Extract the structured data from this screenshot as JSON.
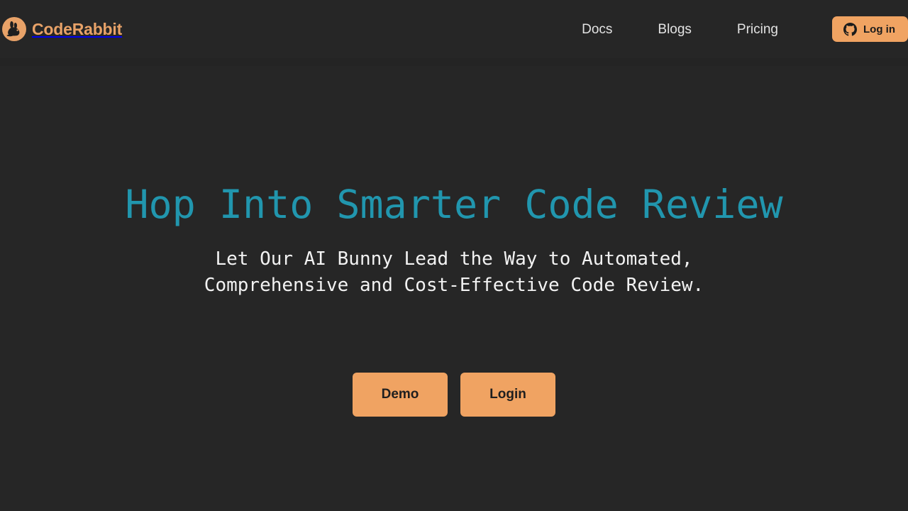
{
  "colors": {
    "background": "#262626",
    "header_band": "#242424",
    "brand_orange": "#e8a268",
    "button_orange": "#f0a362",
    "heading_teal": "#2196ae",
    "nav_text": "#e3e3e3",
    "subtitle_text": "#f2f2f2",
    "button_text": "#1f1f1f"
  },
  "header": {
    "brand": {
      "name": "CodeRabbit",
      "logo_icon": "rabbit-logo-icon"
    },
    "nav": [
      {
        "label": "Docs"
      },
      {
        "label": "Blogs"
      },
      {
        "label": "Pricing"
      }
    ],
    "login": {
      "label": "Log in",
      "icon": "github-icon"
    }
  },
  "hero": {
    "title": "Hop Into Smarter Code Review",
    "subtitle": "Let Our AI Bunny Lead the Way to Automated,\nComprehensive and Cost-Effective Code Review.",
    "buttons": [
      {
        "label": "Demo"
      },
      {
        "label": "Login"
      }
    ]
  }
}
